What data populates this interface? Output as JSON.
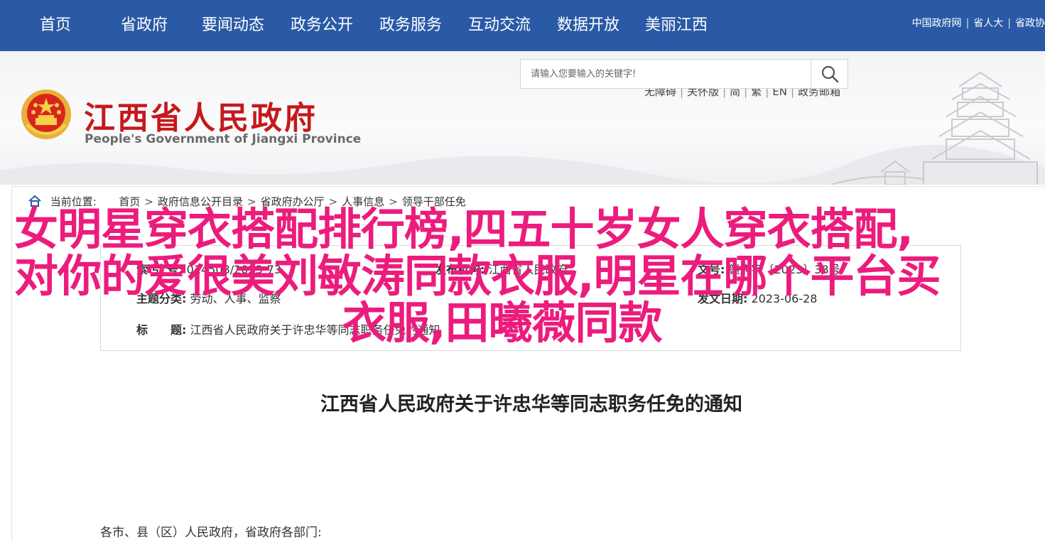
{
  "topnav": {
    "items": [
      "首页",
      "省政府",
      "要闻动态",
      "政务公开",
      "政务服务",
      "互动交流",
      "数据开放",
      "美丽江西"
    ],
    "links": [
      "中国政府网",
      "省人大",
      "省政协"
    ]
  },
  "header": {
    "title": "江西省人民政府",
    "subtitle": "People's Government of Jiangxi Province",
    "util_links": [
      "无障碍",
      "关怀版",
      "简",
      "繁",
      "EN",
      "政务邮箱"
    ],
    "search_placeholder": "请输入您要输入的关键字!"
  },
  "breadcrumb": {
    "label": "当前位置:",
    "items": [
      "首页",
      "政府信息公开目录",
      "省政府办公厅",
      "人事信息",
      "领导干部任免"
    ]
  },
  "meta": {
    "index_key": "索 引 号:",
    "index_value": "014508",
    "index_year": "2023",
    "index_no": "73",
    "issuer_key": "发布机构:",
    "issuer_value": "江西省人民政府",
    "doc_no_key": "文号:",
    "doc_no_value": "赣府字〔2023〕38号",
    "category_key": "主题分类:",
    "category_value": "劳动、人事、监察",
    "date_key": "发文日期:",
    "date_value": "2023-06-28",
    "subject_key": "标　　题:",
    "subject_value": "江西省人民政府关于许忠华等同志职务任免的通知"
  },
  "article": {
    "title": "江西省人民政府关于许忠华等同志职务任免的通知",
    "salutation": "各市、县（区）人民政府，省政府各部门:"
  },
  "overlay": {
    "line1": "女明星穿衣搭配排行榜,四五十岁女人穿衣搭配,",
    "line2": "对你的爱很美刘敏涛同款衣服,明星在哪个平台买",
    "line3": "衣服,田曦薇同款"
  },
  "colors": {
    "nav_bg": "#2a5aa6",
    "title_red": "#c4191d",
    "overlay_pink": "#ec1c7d"
  }
}
